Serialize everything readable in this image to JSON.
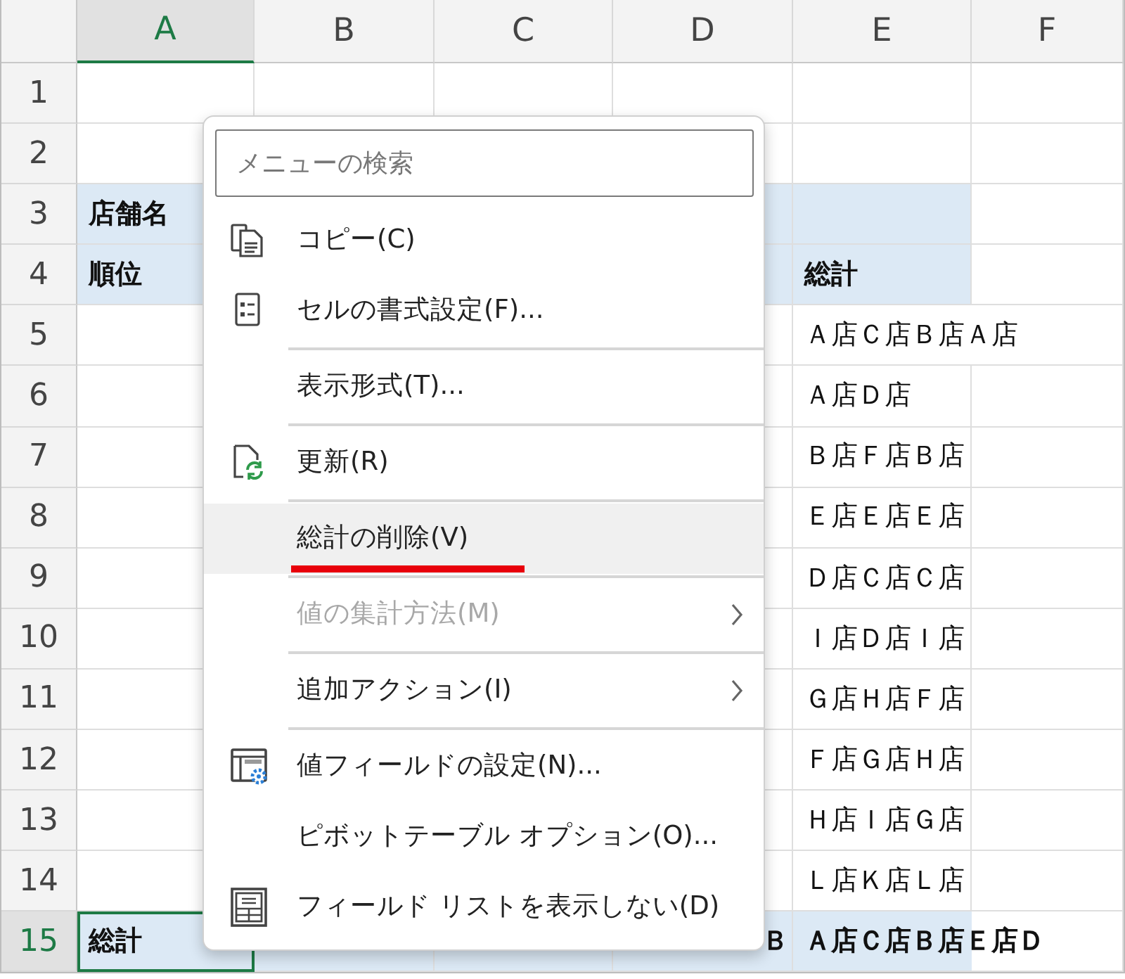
{
  "sheet": {
    "columns": [
      {
        "label": "A",
        "selected": true
      },
      {
        "label": "B",
        "selected": false
      },
      {
        "label": "C",
        "selected": false
      },
      {
        "label": "D",
        "selected": false
      },
      {
        "label": "E",
        "selected": false
      },
      {
        "label": "F",
        "selected": false
      }
    ],
    "rows": [
      {
        "label": "1",
        "selected": false,
        "shaded": false,
        "cells": [
          "",
          "",
          "",
          "",
          "",
          ""
        ]
      },
      {
        "label": "2",
        "selected": false,
        "shaded": false,
        "cells": [
          "",
          "",
          "",
          "",
          "",
          ""
        ]
      },
      {
        "label": "3",
        "selected": false,
        "bold": true,
        "shaded": true,
        "cells": [
          "店舗名",
          "",
          "",
          "",
          "",
          ""
        ]
      },
      {
        "label": "4",
        "selected": false,
        "bold": true,
        "shaded": true,
        "cells": [
          "順位",
          "",
          "",
          "",
          "総計",
          ""
        ]
      },
      {
        "label": "5",
        "selected": false,
        "bold": false,
        "shaded": false,
        "cells": [
          "",
          "",
          "",
          "",
          "Ａ店Ｃ店Ｂ店Ａ店",
          ""
        ]
      },
      {
        "label": "6",
        "selected": false,
        "bold": false,
        "shaded": false,
        "cells": [
          "",
          "",
          "",
          "",
          "Ａ店Ｄ店",
          ""
        ]
      },
      {
        "label": "7",
        "selected": false,
        "bold": false,
        "shaded": false,
        "cells": [
          "",
          "",
          "",
          "",
          "Ｂ店Ｆ店Ｂ店",
          ""
        ]
      },
      {
        "label": "8",
        "selected": false,
        "bold": false,
        "shaded": false,
        "cells": [
          "",
          "",
          "",
          "",
          "Ｅ店Ｅ店Ｅ店",
          ""
        ]
      },
      {
        "label": "9",
        "selected": false,
        "bold": false,
        "shaded": false,
        "cells": [
          "",
          "",
          "",
          "",
          "Ｄ店Ｃ店Ｃ店",
          ""
        ]
      },
      {
        "label": "10",
        "selected": false,
        "bold": false,
        "shaded": false,
        "cells": [
          "",
          "",
          "",
          "",
          "Ｉ店Ｄ店Ｉ店",
          ""
        ]
      },
      {
        "label": "11",
        "selected": false,
        "bold": false,
        "shaded": false,
        "cells": [
          "",
          "",
          "",
          "",
          "Ｇ店Ｈ店Ｆ店",
          ""
        ]
      },
      {
        "label": "12",
        "selected": false,
        "bold": false,
        "shaded": false,
        "cells": [
          "",
          "",
          "",
          "",
          "Ｆ店Ｇ店Ｈ店",
          ""
        ]
      },
      {
        "label": "13",
        "selected": false,
        "bold": false,
        "shaded": false,
        "cells": [
          "",
          "",
          "",
          "",
          "Ｈ店Ｉ店Ｇ店",
          ""
        ]
      },
      {
        "label": "14",
        "selected": false,
        "bold": false,
        "shaded": false,
        "cells": [
          "",
          "",
          "",
          "",
          "Ｌ店Ｋ店Ｌ店",
          ""
        ]
      },
      {
        "label": "15",
        "selected": true,
        "bold": true,
        "shaded": true,
        "cells": [
          "総計",
          "",
          "",
          "Ｂ",
          "Ａ店Ｃ店Ｂ店Ｅ店Ｄ",
          ""
        ]
      }
    ]
  },
  "context_menu": {
    "search": {
      "placeholder": "メニューの検索"
    },
    "items": [
      {
        "kind": "copy",
        "label": "コピー(C)",
        "selected": false,
        "disabled": false,
        "submenu": false,
        "marked": false
      },
      {
        "kind": "format",
        "label": "セルの書式設定(F)...",
        "selected": false,
        "disabled": false,
        "submenu": false,
        "marked": false
      },
      {
        "kind": "separator"
      },
      {
        "kind": "plain",
        "label": "表示形式(T)...",
        "selected": false,
        "disabled": false,
        "submenu": false,
        "marked": false
      },
      {
        "kind": "separator"
      },
      {
        "kind": "refresh",
        "label": "更新(R)",
        "selected": false,
        "disabled": false,
        "submenu": false,
        "marked": false
      },
      {
        "kind": "separator"
      },
      {
        "kind": "plain",
        "label": "総計の削除(V)",
        "selected": true,
        "disabled": false,
        "submenu": false,
        "marked": true
      },
      {
        "kind": "separator"
      },
      {
        "kind": "plain",
        "label": "値の集計方法(M)",
        "selected": false,
        "disabled": true,
        "submenu": true,
        "marked": false
      },
      {
        "kind": "separator"
      },
      {
        "kind": "plain",
        "label": "追加アクション(I)",
        "selected": false,
        "disabled": false,
        "submenu": true,
        "marked": false
      },
      {
        "kind": "separator"
      },
      {
        "kind": "field-settings",
        "label": "値フィールドの設定(N)...",
        "selected": false,
        "disabled": false,
        "submenu": false,
        "marked": false
      },
      {
        "kind": "plain",
        "label": "ピボットテーブル オプション(O)...",
        "selected": false,
        "disabled": false,
        "submenu": false,
        "marked": false
      },
      {
        "kind": "field-list",
        "label": "フィールド リストを表示しない(D)",
        "selected": false,
        "disabled": false,
        "submenu": false,
        "marked": false
      }
    ]
  }
}
